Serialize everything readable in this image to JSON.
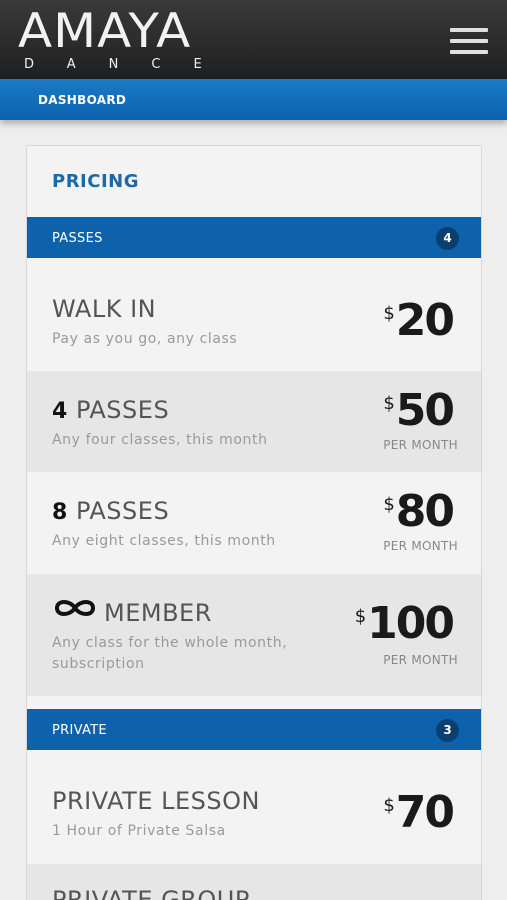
{
  "header": {
    "logo_main": "AMAYA",
    "logo_sub": "DANCE",
    "menu_icon": "hamburger-menu-icon"
  },
  "breadcrumb": {
    "label": "DASHBOARD"
  },
  "pricing": {
    "title": "PRICING",
    "sections": [
      {
        "label": "PASSES",
        "count": "4",
        "items": [
          {
            "title": "WALK IN",
            "desc": "Pay as you go, any class",
            "currency": "$",
            "price": "20",
            "per": ""
          },
          {
            "num": "4",
            "title": "PASSES",
            "desc": "Any four classes, this month",
            "currency": "$",
            "price": "50",
            "per": "PER MONTH"
          },
          {
            "num": "8",
            "title": "PASSES",
            "desc": "Any eight classes, this month",
            "currency": "$",
            "price": "80",
            "per": "PER MONTH"
          },
          {
            "icon": "infinity-icon",
            "title": "MEMBER",
            "desc": "Any class for the whole month, subscription",
            "currency": "$",
            "price": "100",
            "per": "PER MONTH"
          }
        ]
      },
      {
        "label": "PRIVATE",
        "count": "3",
        "items": [
          {
            "title": "PRIVATE LESSON",
            "desc": "1 Hour of Private Salsa",
            "currency": "$",
            "price": "70",
            "per": ""
          },
          {
            "title": "PRIVATE GROUP",
            "desc": "",
            "currency": "",
            "price": "",
            "per": ""
          }
        ]
      }
    ]
  },
  "colors": {
    "header_bg": "#2b2b2b",
    "accent_blue": "#0d62ab",
    "title_blue": "#1a6aa8"
  }
}
